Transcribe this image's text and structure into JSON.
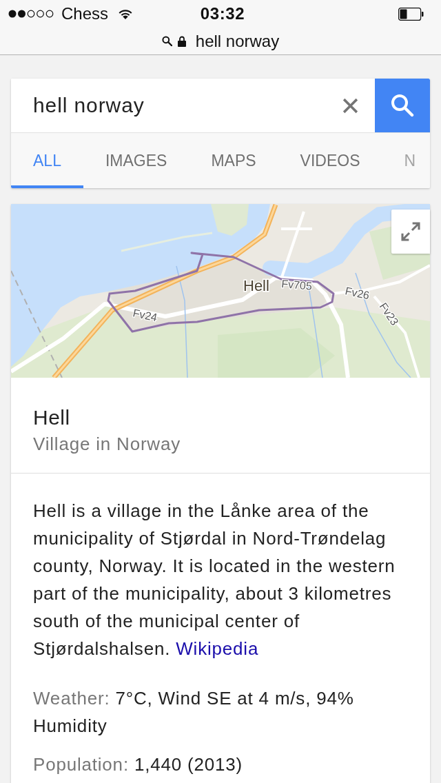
{
  "status_bar": {
    "carrier": "Chess",
    "time": "03:32"
  },
  "address_bar": {
    "url": "hell norway"
  },
  "search": {
    "value": "hell norway"
  },
  "tabs": [
    {
      "label": "ALL",
      "selected": true,
      "cut_off": false
    },
    {
      "label": "IMAGES",
      "selected": false,
      "cut_off": false
    },
    {
      "label": "MAPS",
      "selected": false,
      "cut_off": false
    },
    {
      "label": "VIDEOS",
      "selected": false,
      "cut_off": false
    },
    {
      "label": "N",
      "selected": false,
      "cut_off": true
    }
  ],
  "map": {
    "labels": [
      {
        "text": "Hell",
        "kind": "place"
      },
      {
        "text": "Fv705",
        "kind": "road"
      },
      {
        "text": "Fv26",
        "kind": "road"
      },
      {
        "text": "Fv24",
        "kind": "road"
      },
      {
        "text": "Fv23",
        "kind": "road"
      }
    ]
  },
  "place": {
    "title": "Hell",
    "subtitle": "Village in Norway",
    "description": "Hell is a village in the Lånke area of the municipality of Stjørdal in Nord-Trøndelag county, Norway. It is located in the western part of the municipality, about 3 kilometres south of the municipal center of Stjørdalshalsen.",
    "source_link": "Wikipedia",
    "facts": [
      {
        "label": "Weather:",
        "value": "7°C, Wind SE at 4 m/s, 94% Humidity"
      },
      {
        "label": "Population:",
        "value": "1,440 (2013)"
      }
    ]
  }
}
